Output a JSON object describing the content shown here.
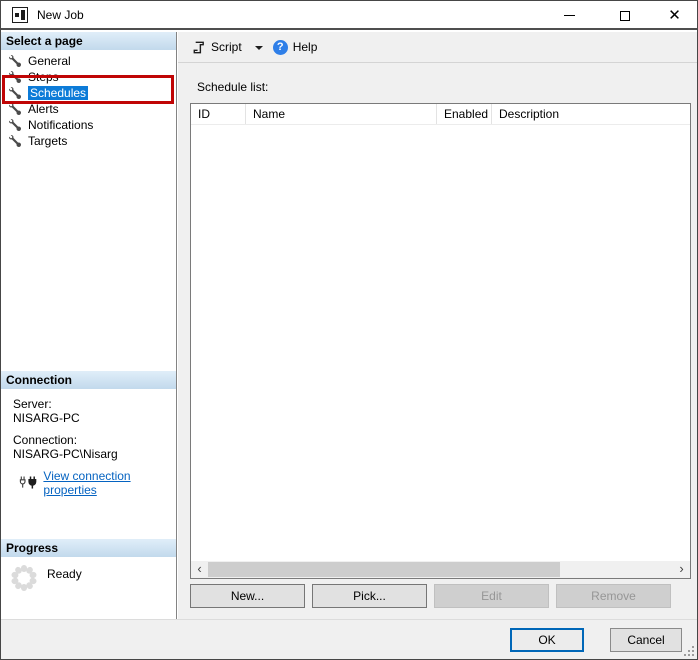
{
  "window": {
    "title": "New Job"
  },
  "sidebar": {
    "header": "Select a page",
    "pages": [
      {
        "label": "General"
      },
      {
        "label": "Steps"
      },
      {
        "label": "Schedules",
        "selected": true
      },
      {
        "label": "Alerts"
      },
      {
        "label": "Notifications"
      },
      {
        "label": "Targets"
      }
    ],
    "connection": {
      "header": "Connection",
      "server_label": "Server:",
      "server_value": "NISARG-PC",
      "connection_label": "Connection:",
      "connection_value": "NISARG-PC\\Nisarg",
      "link_label": "View connection properties"
    },
    "progress": {
      "header": "Progress",
      "status": "Ready"
    }
  },
  "toolbar": {
    "script_label": "Script",
    "help_label": "Help"
  },
  "main": {
    "schedule_list_label": "Schedule list:",
    "table": {
      "columns": [
        "ID",
        "Name",
        "Enabled",
        "Description"
      ],
      "rows": []
    },
    "action_buttons": {
      "new": "New...",
      "pick": "Pick...",
      "edit": "Edit",
      "remove": "Remove"
    }
  },
  "footer": {
    "ok": "OK",
    "cancel": "Cancel"
  },
  "colors": {
    "selection_bg": "#0c7bd8",
    "annotation_red": "#c00505",
    "link_blue": "#0563c1",
    "help_icon_blue": "#2f7fe8",
    "ok_border_blue": "#0067b8"
  }
}
